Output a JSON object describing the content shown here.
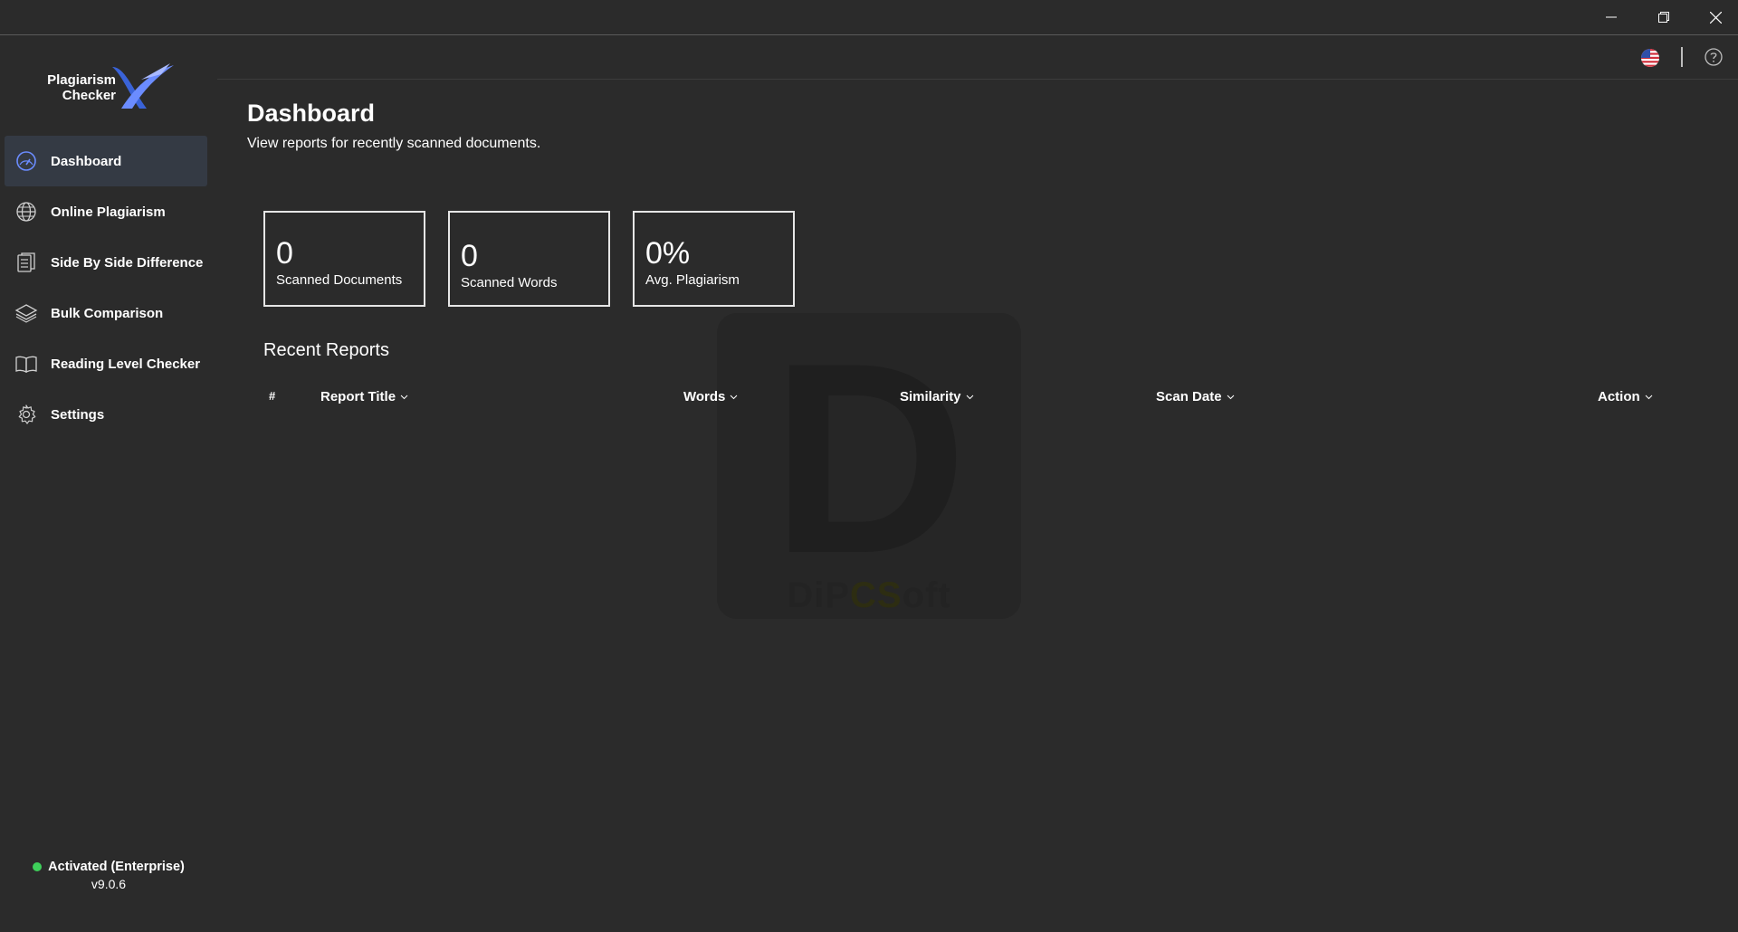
{
  "window": {
    "controls": [
      "minimize-icon",
      "restore-icon",
      "close-icon"
    ]
  },
  "app": {
    "logo_line1": "Plagiarism",
    "logo_line2": "Checker",
    "logo_mark": "X"
  },
  "sidebar": {
    "items": [
      {
        "label": "Dashboard",
        "icon": "gauge-icon",
        "active": true
      },
      {
        "label": "Online Plagiarism",
        "icon": "globe-icon",
        "active": false
      },
      {
        "label": "Side By Side Difference",
        "icon": "document-compare-icon",
        "active": false
      },
      {
        "label": "Bulk Comparison",
        "icon": "layers-icon",
        "active": false
      },
      {
        "label": "Reading Level Checker",
        "icon": "book-icon",
        "active": false
      },
      {
        "label": "Settings",
        "icon": "gear-icon",
        "active": false
      }
    ],
    "status": "Activated (Enterprise)",
    "version": "v9.0.6",
    "status_color": "#3ecf5a"
  },
  "topbar": {
    "language_icon": "us-flag-icon",
    "help_icon": "help-icon"
  },
  "main": {
    "title": "Dashboard",
    "subtitle": "View reports for recently scanned documents.",
    "stats": [
      {
        "value": "0",
        "label": "Scanned Documents"
      },
      {
        "value": "0",
        "label": "Scanned Words"
      },
      {
        "value": "0%",
        "label": "Avg. Plagiarism"
      }
    ],
    "recent_title": "Recent Reports",
    "table": {
      "columns": [
        "#",
        "Report Title",
        "Words",
        "Similarity",
        "Scan Date",
        "Action"
      ],
      "rows": []
    },
    "watermark": {
      "letter": "D",
      "text_part1": "DiP",
      "text_part2": "CS",
      "text_part3": "oft"
    }
  },
  "colors": {
    "background": "#2b2b2b",
    "active_nav": "#343a44",
    "logo_blue": "#3a63d8"
  }
}
